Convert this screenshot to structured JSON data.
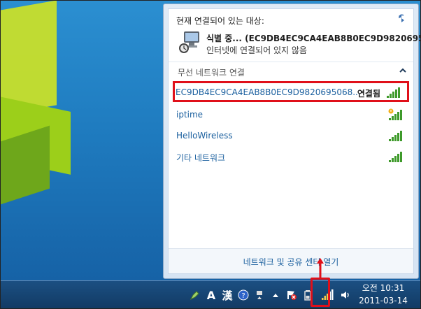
{
  "current": {
    "header": "현재 연결되어 있는 대상:",
    "network_name": "식별 중... (EC9DB4EC9CA4EAB8B0EC9D982069506...",
    "status": "인터넷에 연결되어 있지 않음"
  },
  "wireless": {
    "header": "무선 네트워크 연결",
    "items": [
      {
        "label": "EC9DB4EC9CA4EAB8B0EC9D9820695068...",
        "status": "연결됨"
      },
      {
        "label": "iptime"
      },
      {
        "label": "HelloWireless"
      },
      {
        "label": "기타 네트워크"
      }
    ]
  },
  "footer": {
    "link": "네트워크 및 공유 센터 열기"
  },
  "taskbar": {
    "ime_a": "A",
    "ime_han": "漢",
    "time": "오전 10:31",
    "date": "2011-03-14"
  },
  "colors": {
    "highlight": "#e0101a",
    "link": "#1a5f9e",
    "signal": "#3e9a2a"
  }
}
